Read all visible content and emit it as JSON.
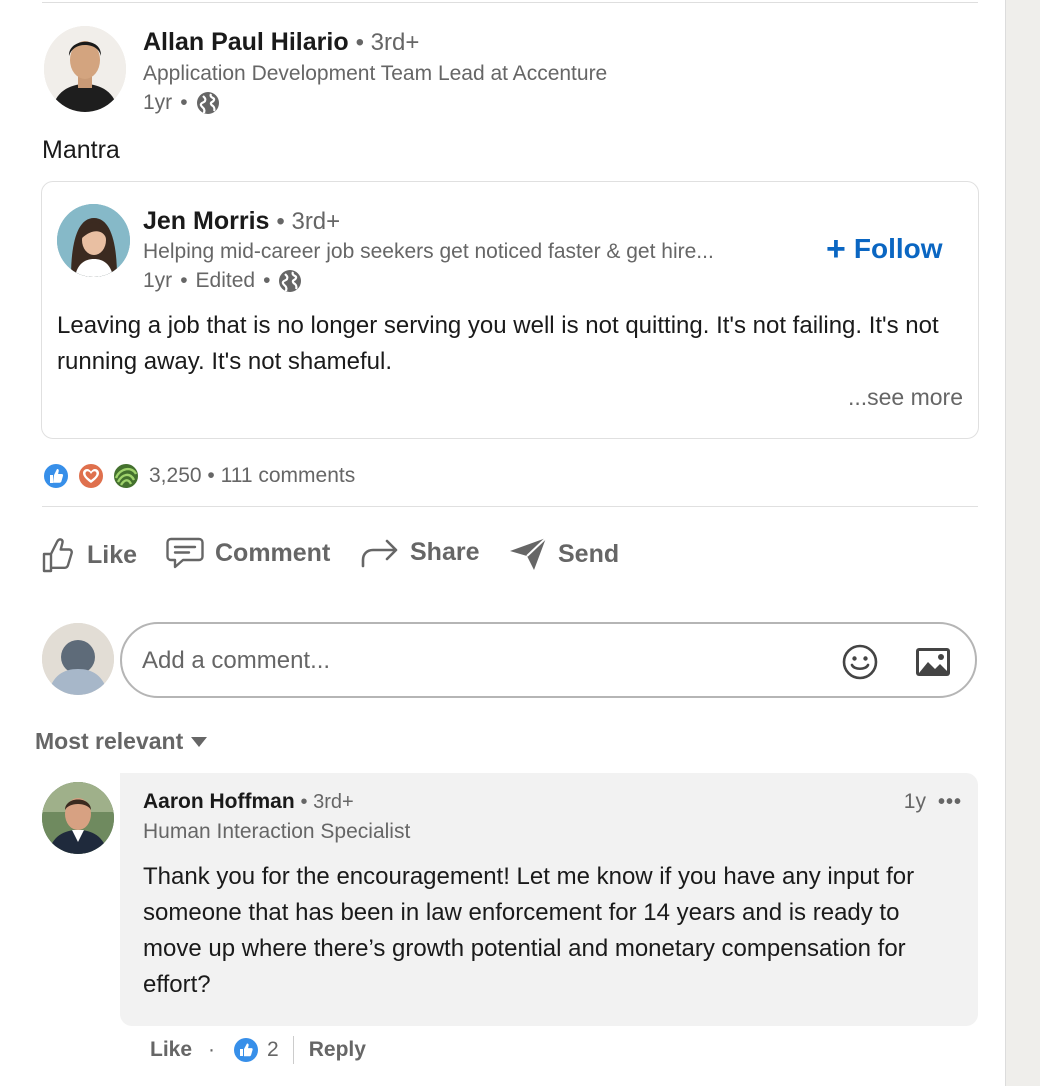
{
  "post": {
    "author_name": "Allan Paul Hilario",
    "author_degree": "3rd+",
    "author_title": "Application Development Team Lead at Accenture",
    "time": "1yr",
    "text": "Mantra"
  },
  "shared_post": {
    "author_name": "Jen Morris",
    "author_degree": "3rd+",
    "headline": "Helping mid-career job seekers get noticed faster & get hire...",
    "time": "1yr",
    "edited": "Edited",
    "follow_label": "Follow",
    "text": "Leaving a job that is no longer serving you well is not quitting. It's not failing. It's not running away. It's not shameful.",
    "see_more": "...see more"
  },
  "reactions": {
    "count": "3,250",
    "comments": "111 comments",
    "icons": [
      "like-icon",
      "love-icon",
      "insightful-icon"
    ],
    "colors": {
      "like": "#378fe9",
      "love": "#df704d",
      "insightful": "#44712e"
    }
  },
  "actions": {
    "like": "Like",
    "comment": "Comment",
    "share": "Share",
    "send": "Send"
  },
  "comment_box": {
    "placeholder": "Add a comment..."
  },
  "sort_label": "Most relevant",
  "comment": {
    "author_name": "Aaron Hoffman",
    "author_degree": "3rd+",
    "headline": "Human Interaction Specialist",
    "time": "1y",
    "text": "Thank you for the encouragement! Let me know if you have any input for someone that has been in law enforcement for 14 years and is ready to move up where there’s growth potential and monetary compensation for effort?",
    "like_label": "Like",
    "like_count": "2",
    "reply_label": "Reply"
  },
  "theme": {
    "accent": "#0a66c2",
    "muted_text": "#666666",
    "comment_bg": "#f2f2f2"
  }
}
